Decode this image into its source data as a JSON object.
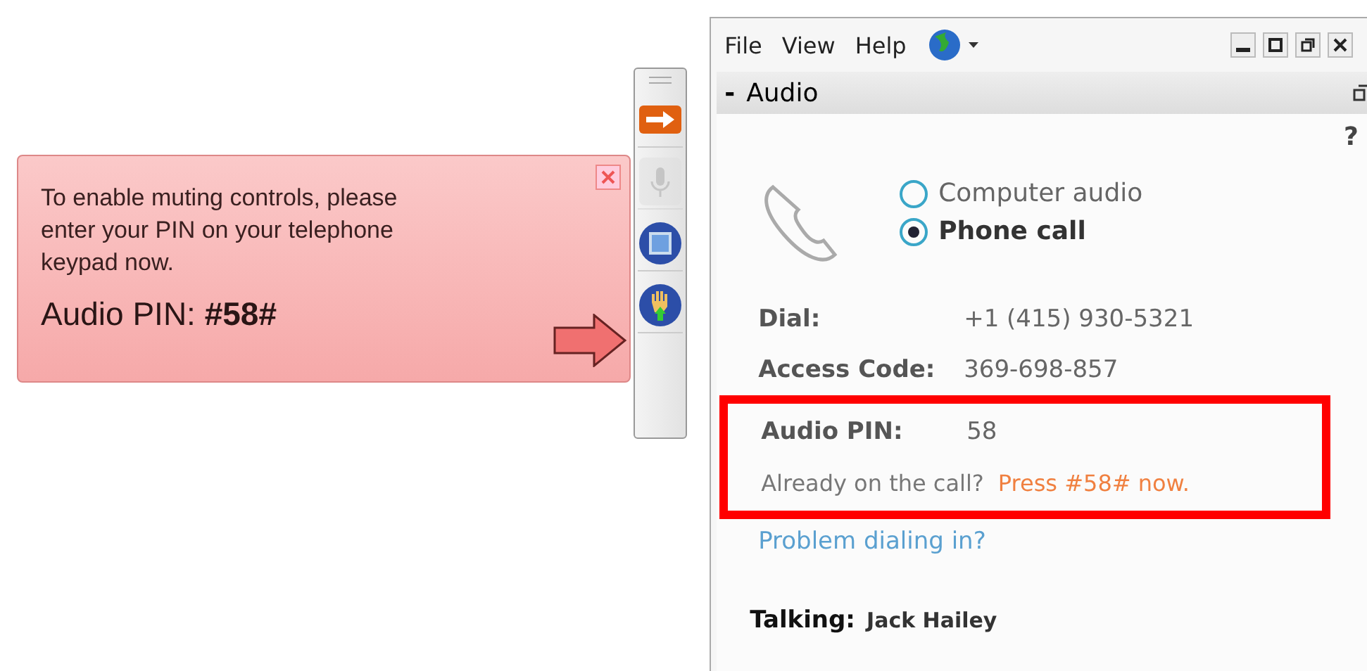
{
  "callout": {
    "message": "To enable muting controls, please enter your PIN on your telephone keypad now.",
    "pin_line": "Audio PIN: **#58#**"
  },
  "toolbar": [
    {
      "kind": "share",
      "disabled": false
    },
    {
      "kind": "mic",
      "disabled": true
    },
    {
      "kind": "stop",
      "disabled": false
    },
    {
      "kind": "hand",
      "disabled": false
    }
  ],
  "window": {
    "menu": [
      "File",
      "View",
      "Help"
    ],
    "panel": {
      "toggle": "-",
      "title": "Audio",
      "help": "?",
      "options": [
        {
          "label": "Computer audio",
          "selected": false
        },
        {
          "label": "Phone call",
          "selected": true
        }
      ],
      "fields": [
        {
          "label": "Dial:",
          "value": "+1 (415) 930-5321"
        },
        {
          "label": "Access Code:",
          "value": "369-698-857"
        }
      ],
      "pin": {
        "highlighted": true,
        "label": "Audio PIN:",
        "value": "58",
        "question": "Already on the call?",
        "instruction": "Press #58# now."
      },
      "link": "Problem dialing in?",
      "talking_label": "Talking:",
      "talking_name": "Jack Hailey"
    }
  }
}
